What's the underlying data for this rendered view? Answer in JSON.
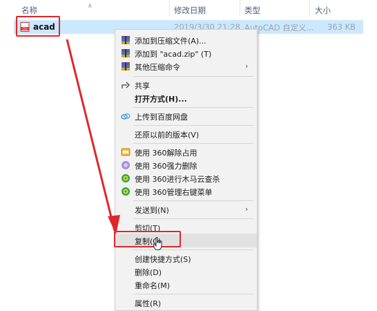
{
  "columns": {
    "name": "名称",
    "modified": "修改日期",
    "type": "类型",
    "size": "大小"
  },
  "file": {
    "name": "acad",
    "modified": "2019/3/30 21:28",
    "type": "AutoCAD 自定义...",
    "size": "363 KB",
    "icon": "cui-file-icon"
  },
  "menu": {
    "items": [
      {
        "label": "添加到压缩文件(A)...",
        "icon": "winrar-icon"
      },
      {
        "label": "添加到 \"acad.zip\" (T)",
        "icon": "winrar-icon"
      },
      {
        "label": "其他压缩命令",
        "icon": "winrar-icon",
        "submenu": "›"
      },
      {
        "label": "共享",
        "icon": "share-icon"
      },
      {
        "label": "打开方式(H)...",
        "bold": true
      },
      {
        "label": "上传到百度网盘",
        "icon": "baidu-cloud-icon"
      },
      {
        "label": "还原以前的版本(V)"
      },
      {
        "label": "使用 360解除占用",
        "icon": "360-unlock-icon"
      },
      {
        "label": "使用 360强力删除",
        "icon": "360-shred-icon"
      },
      {
        "label": "使用 360进行木马云查杀",
        "icon": "360-scan-icon"
      },
      {
        "label": "使用 360管理右键菜单",
        "icon": "360-manage-icon"
      },
      {
        "label": "发送到(N)",
        "submenu": "›"
      },
      {
        "label": "剪切(T)"
      },
      {
        "label": "复制(C)"
      },
      {
        "label": "创建快捷方式(S)"
      },
      {
        "label": "删除(D)"
      },
      {
        "label": "重命名(M)"
      },
      {
        "label": "属性(R)"
      }
    ]
  },
  "colors": {
    "selection": "#cce8ff",
    "highlight": "#e0262a",
    "menu_bg": "#f2f2f2",
    "hover_bg": "#e1e1e1"
  }
}
